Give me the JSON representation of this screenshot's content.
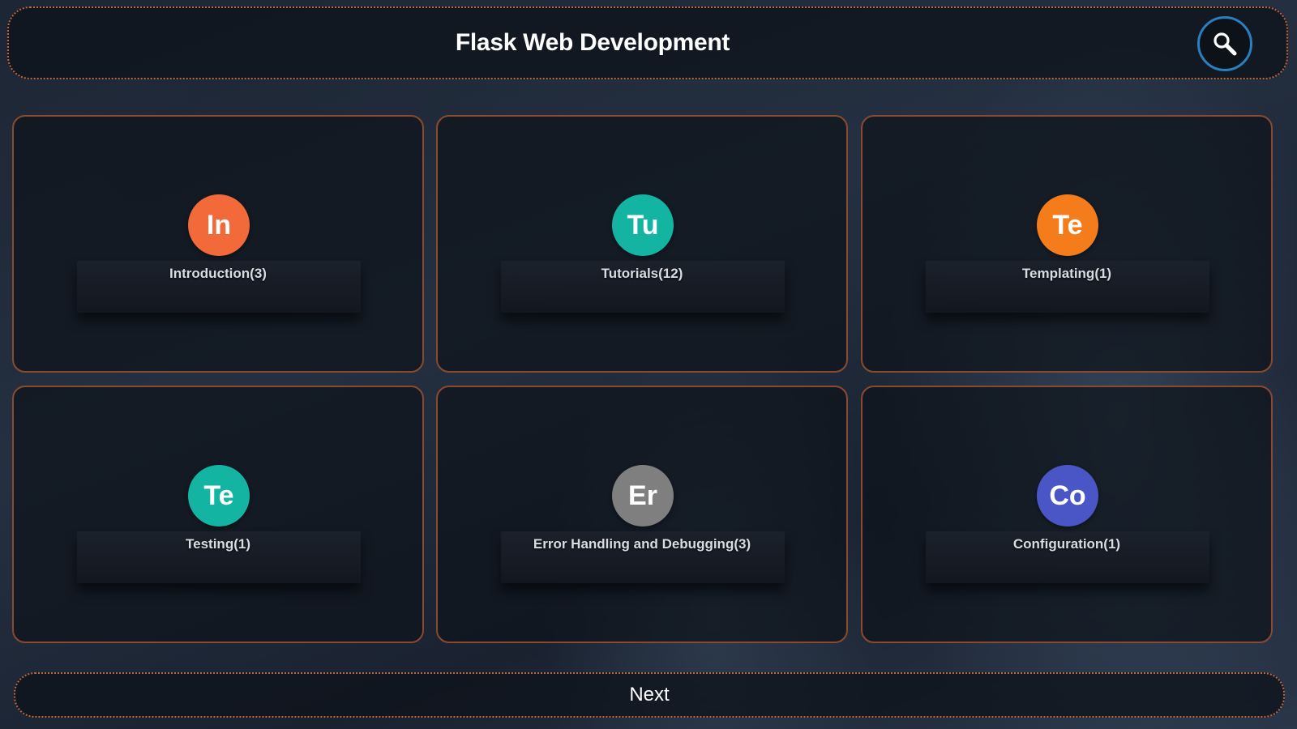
{
  "header": {
    "title": "Flask Web Development",
    "search_icon": "search-icon"
  },
  "categories": [
    {
      "initials": "In",
      "label": "Introduction(3)",
      "color": "#f26a3a"
    },
    {
      "initials": "Tu",
      "label": "Tutorials(12)",
      "color": "#13b5a2"
    },
    {
      "initials": "Te",
      "label": "Templating(1)",
      "color": "#f57c1b"
    },
    {
      "initials": "Te",
      "label": "Testing(1)",
      "color": "#13b5a2"
    },
    {
      "initials": "Er",
      "label": "Error Handling and Debugging(3)",
      "color": "#7f7f7f"
    },
    {
      "initials": "Co",
      "label": "Configuration(1)",
      "color": "#4a56c6"
    }
  ],
  "footer": {
    "next_label": "Next"
  },
  "colors": {
    "border_accent": "#c0673f",
    "search_ring": "#2a7fc1"
  }
}
